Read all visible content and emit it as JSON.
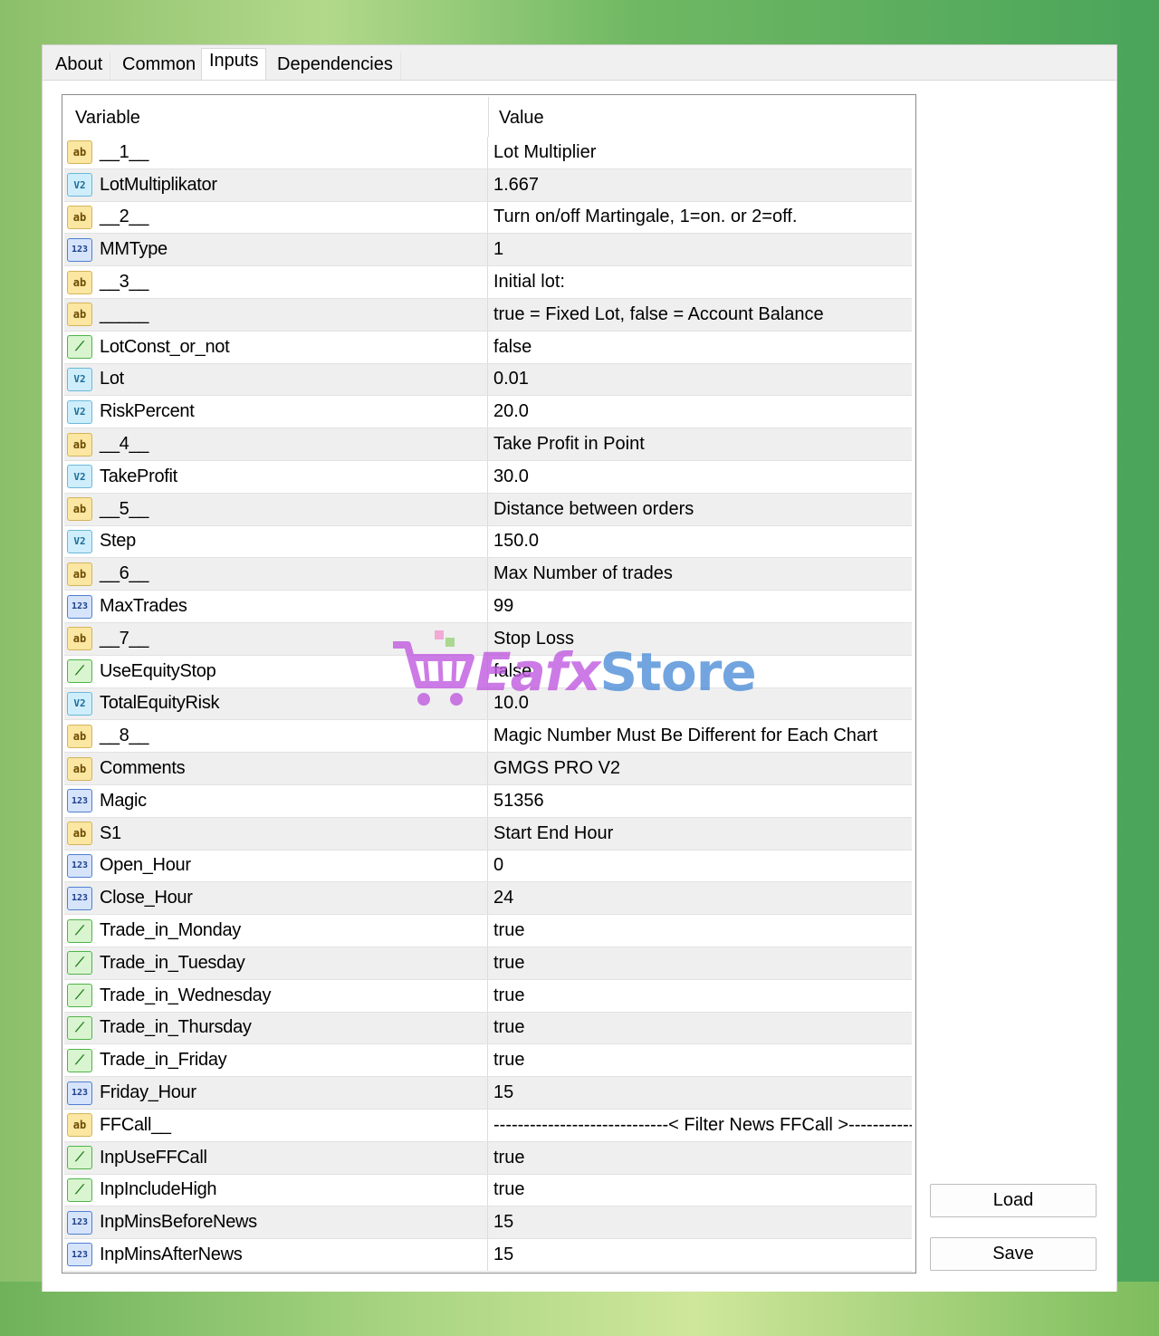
{
  "tabs": [
    {
      "label": "About"
    },
    {
      "label": "Common"
    },
    {
      "label": "Inputs"
    },
    {
      "label": "Dependencies"
    }
  ],
  "active_tab": "Inputs",
  "grid": {
    "header_variable": "Variable",
    "header_value": "Value",
    "rows": [
      {
        "type": "ab",
        "name": "__1__",
        "value": "Lot Multiplier"
      },
      {
        "type": "v2",
        "name": "LotMultiplikator",
        "value": "1.667"
      },
      {
        "type": "ab",
        "name": "__2__",
        "value": " Turn on/off Martingale,  1=on. or 2=off."
      },
      {
        "type": "n123",
        "name": "MMType",
        "value": "1"
      },
      {
        "type": "ab",
        "name": "__3__",
        "value": "Initial lot:"
      },
      {
        "type": "ab",
        "name": "_____",
        "value": "true = Fixed Lot, false = Account Balance"
      },
      {
        "type": "bool",
        "name": "LotConst_or_not",
        "value": "false"
      },
      {
        "type": "v2",
        "name": "Lot",
        "value": "0.01"
      },
      {
        "type": "v2",
        "name": "RiskPercent",
        "value": "20.0"
      },
      {
        "type": "ab",
        "name": "__4__",
        "value": "Take Profit in Point"
      },
      {
        "type": "v2",
        "name": "TakeProfit",
        "value": "30.0"
      },
      {
        "type": "ab",
        "name": "__5__",
        "value": "Distance between orders"
      },
      {
        "type": "v2",
        "name": "Step",
        "value": "150.0"
      },
      {
        "type": "ab",
        "name": "__6__",
        "value": "Max Number of trades"
      },
      {
        "type": "n123",
        "name": "MaxTrades",
        "value": "99"
      },
      {
        "type": "ab",
        "name": "__7__",
        "value": "Stop Loss"
      },
      {
        "type": "bool",
        "name": "UseEquityStop",
        "value": "false"
      },
      {
        "type": "v2",
        "name": "TotalEquityRisk",
        "value": "10.0"
      },
      {
        "type": "ab",
        "name": "__8__",
        "value": "Magic Number Must Be Different for Each Chart"
      },
      {
        "type": "ab",
        "name": "Comments",
        "value": "GMGS PRO V2"
      },
      {
        "type": "n123",
        "name": "Magic",
        "value": "51356"
      },
      {
        "type": "ab",
        "name": "S1",
        "value": " Start End Hour"
      },
      {
        "type": "n123",
        "name": "Open_Hour",
        "value": "0"
      },
      {
        "type": "n123",
        "name": "Close_Hour",
        "value": "24"
      },
      {
        "type": "bool",
        "name": "Trade_in_Monday",
        "value": "true"
      },
      {
        "type": "bool",
        "name": "Trade_in_Tuesday",
        "value": "true"
      },
      {
        "type": "bool",
        "name": "Trade_in_Wednesday",
        "value": "true"
      },
      {
        "type": "bool",
        "name": "Trade_in_Thursday",
        "value": "true"
      },
      {
        "type": "bool",
        "name": "Trade_in_Friday",
        "value": "true"
      },
      {
        "type": "n123",
        "name": "Friday_Hour",
        "value": "15"
      },
      {
        "type": "ab",
        "name": "FFCall__",
        "value": "-----------------------------< Filter News FFCall >-----------------------..."
      },
      {
        "type": "bool",
        "name": "InpUseFFCall",
        "value": "true"
      },
      {
        "type": "bool",
        "name": "InpIncludeHigh",
        "value": "true"
      },
      {
        "type": "n123",
        "name": "InpMinsBeforeNews",
        "value": "15"
      },
      {
        "type": "n123",
        "name": "InpMinsAfterNews",
        "value": "15"
      }
    ]
  },
  "icons": {
    "ab": "ab",
    "v2": "V2",
    "n123": "123",
    "bool": "⟋"
  },
  "buttons": {
    "load_label": "Load",
    "save_label": "Save"
  },
  "watermark": {
    "part1": "Eafx",
    "part2": "Store"
  }
}
